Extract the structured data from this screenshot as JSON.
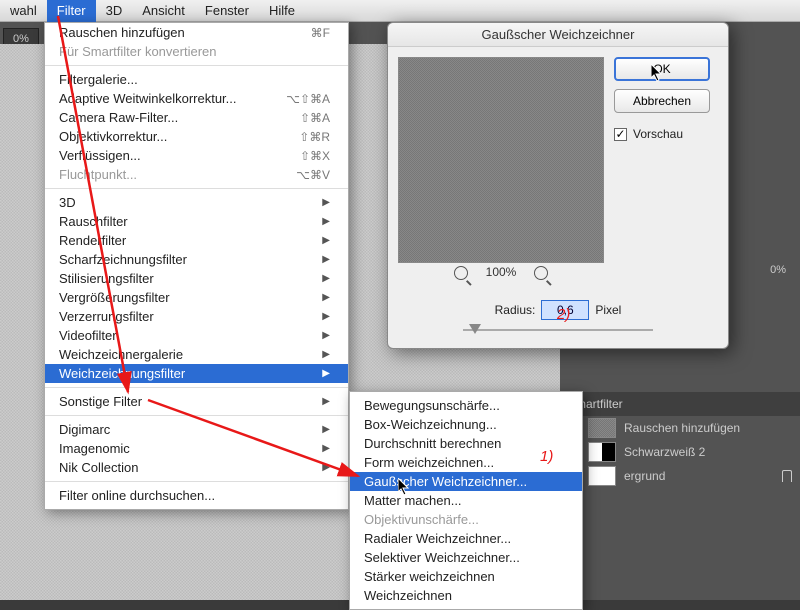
{
  "menubar": {
    "items": [
      "wahl",
      "Filter",
      "3D",
      "Ansicht",
      "Fenster",
      "Hilfe"
    ],
    "active_index": 1
  },
  "toolbar": {
    "zoom_field": "0%"
  },
  "main_menu": [
    {
      "type": "item",
      "label": "Rauschen hinzufügen",
      "shortcut": "⌘F"
    },
    {
      "type": "item",
      "label": "Für Smartfilter konvertieren",
      "disabled": true
    },
    {
      "type": "sep"
    },
    {
      "type": "item",
      "label": "Filtergalerie..."
    },
    {
      "type": "item",
      "label": "Adaptive Weitwinkelkorrektur...",
      "shortcut": "⌥⇧⌘A"
    },
    {
      "type": "item",
      "label": "Camera Raw-Filter...",
      "shortcut": "⇧⌘A"
    },
    {
      "type": "item",
      "label": "Objektivkorrektur...",
      "shortcut": "⇧⌘R"
    },
    {
      "type": "item",
      "label": "Verflüssigen...",
      "shortcut": "⇧⌘X"
    },
    {
      "type": "item",
      "label": "Fluchtpunkt...",
      "shortcut": "⌥⌘V",
      "disabled": true
    },
    {
      "type": "sep"
    },
    {
      "type": "item",
      "label": "3D",
      "sub": true
    },
    {
      "type": "item",
      "label": "Rauschfilter",
      "sub": true
    },
    {
      "type": "item",
      "label": "Renderfilter",
      "sub": true
    },
    {
      "type": "item",
      "label": "Scharfzeichnungsfilter",
      "sub": true
    },
    {
      "type": "item",
      "label": "Stilisierungsfilter",
      "sub": true
    },
    {
      "type": "item",
      "label": "Vergrößerungsfilter",
      "sub": true
    },
    {
      "type": "item",
      "label": "Verzerrungsfilter",
      "sub": true
    },
    {
      "type": "item",
      "label": "Videofilter",
      "sub": true
    },
    {
      "type": "item",
      "label": "Weichzeichnergalerie",
      "sub": true
    },
    {
      "type": "item",
      "label": "Weichzeichnungsfilter",
      "sub": true,
      "selected": true
    },
    {
      "type": "sep"
    },
    {
      "type": "item",
      "label": "Sonstige Filter",
      "sub": true
    },
    {
      "type": "sep"
    },
    {
      "type": "item",
      "label": "Digimarc",
      "sub": true
    },
    {
      "type": "item",
      "label": "Imagenomic",
      "sub": true
    },
    {
      "type": "item",
      "label": "Nik Collection",
      "sub": true
    },
    {
      "type": "sep"
    },
    {
      "type": "item",
      "label": "Filter online durchsuchen..."
    }
  ],
  "submenu": [
    {
      "label": "Bewegungsunschärfe..."
    },
    {
      "label": "Box-Weichzeichnung..."
    },
    {
      "label": "Durchschnitt berechnen"
    },
    {
      "label": "Form weichzeichnen..."
    },
    {
      "label": "Gaußscher Weichzeichner...",
      "selected": true
    },
    {
      "label": "Matter machen..."
    },
    {
      "label": "Objektivunschärfe...",
      "disabled": true
    },
    {
      "label": "Radialer Weichzeichner..."
    },
    {
      "label": "Selektiver Weichzeichner..."
    },
    {
      "label": "Stärker weichzeichnen"
    },
    {
      "label": "Weichzeichnen"
    }
  ],
  "dialog": {
    "title": "Gaußscher Weichzeichner",
    "ok": "OK",
    "cancel": "Abbrechen",
    "preview_label": "Vorschau",
    "preview_checked": true,
    "zoom_percent": "100%",
    "radius_label": "Radius:",
    "radius_value": "0,6",
    "radius_unit": "Pixel"
  },
  "layers": {
    "opacity": "0%",
    "smartfilter": "Smartfilter",
    "items": [
      {
        "label": "Rauschen hinzufügen",
        "swatch": "noise"
      },
      {
        "label": "Schwarzweiß 2",
        "swatch": "bw"
      },
      {
        "label": "ergrund",
        "swatch": "white",
        "locked": true
      }
    ]
  },
  "annotations": {
    "step1": "1)",
    "step2": "2)"
  }
}
